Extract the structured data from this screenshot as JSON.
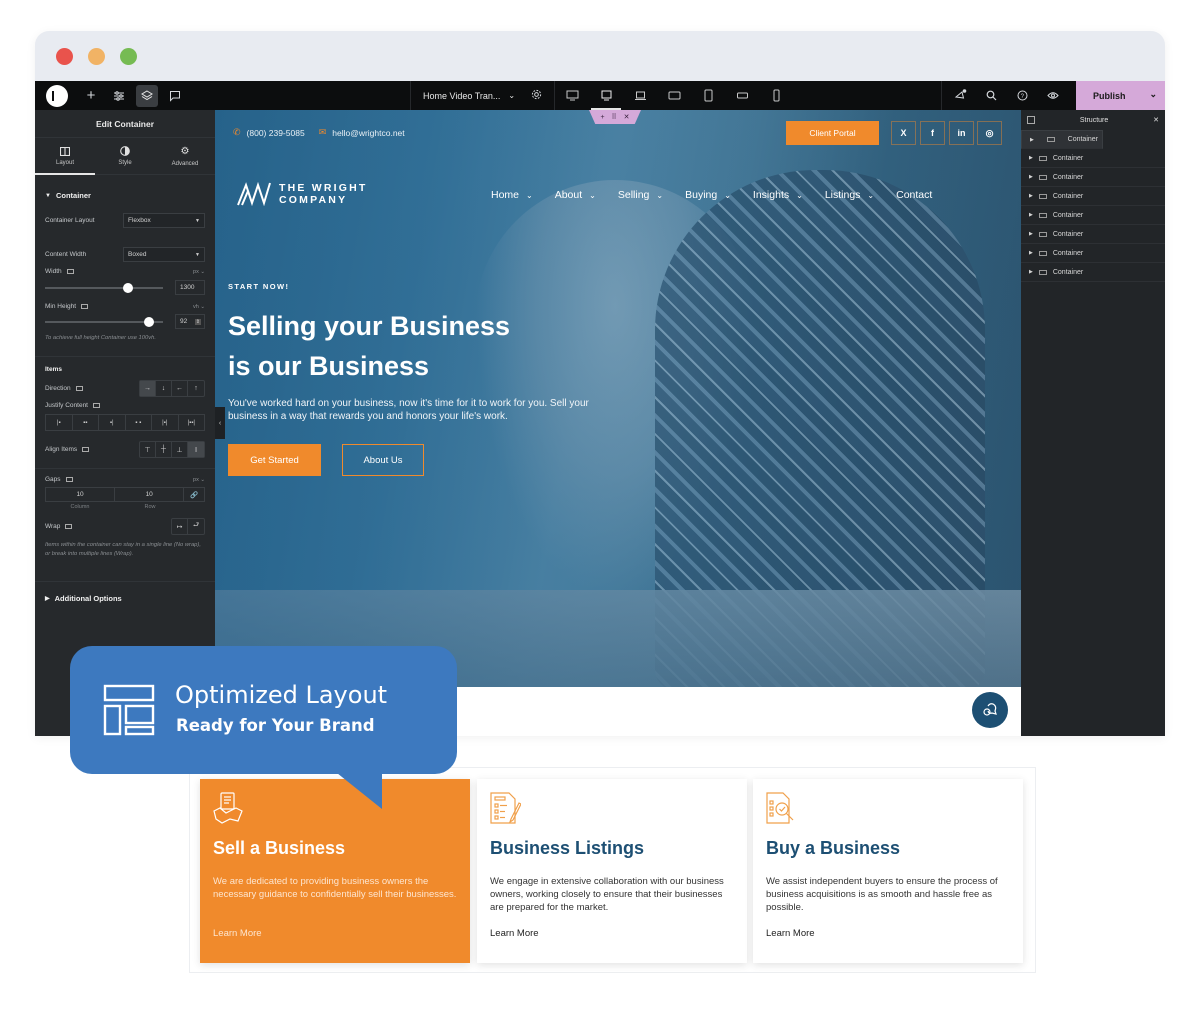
{
  "window": {
    "traffic_lights": [
      "#e9534c",
      "#f1b365",
      "#76bb53"
    ]
  },
  "topbar": {
    "page_name": "Home Video Tran...",
    "publish_label": "Publish",
    "device_modes": [
      "desktop-wide",
      "desktop",
      "laptop",
      "tablet-landscape",
      "tablet",
      "mobile-landscape",
      "mobile"
    ],
    "active_device": "desktop"
  },
  "left_panel": {
    "title": "Edit Container",
    "tabs": [
      {
        "label": "Layout",
        "icon": "columns-icon",
        "active": true
      },
      {
        "label": "Style",
        "icon": "half-circle-icon",
        "active": false
      },
      {
        "label": "Advanced",
        "icon": "gear-icon",
        "active": false
      }
    ],
    "section_container": "Container",
    "container_layout_label": "Container Layout",
    "container_layout_value": "Flexbox",
    "content_width_label": "Content Width",
    "content_width_value": "Boxed",
    "width_label": "Width",
    "width_unit": "px",
    "width_value": "1300",
    "width_slider_fraction": 0.72,
    "min_height_label": "Min Height",
    "min_height_unit": "vh",
    "min_height_value": "92",
    "min_height_slider_fraction": 0.92,
    "min_height_hint": "To achieve full height Container use 100vh.",
    "items_label": "Items",
    "direction_label": "Direction",
    "direction_options": [
      "→",
      "↓",
      "←",
      "↑"
    ],
    "justify_label": "Justify Content",
    "justify_options": [
      "|▪",
      "▪▪",
      "▪|",
      "▪ ▪",
      "|▪|",
      "|▪▪|"
    ],
    "align_label": "Align Items",
    "align_options": [
      "⊤",
      "┼",
      "⊥",
      "Ⅰ"
    ],
    "gaps_label": "Gaps",
    "gaps_unit": "px",
    "gap_column": "10",
    "gap_row": "10",
    "gap_column_label": "Column",
    "gap_row_label": "Row",
    "wrap_label": "Wrap",
    "wrap_hint": "Items within the container can stay in a single line (No wrap), or break into multiple lines (Wrap).",
    "additional_options": "Additional Options"
  },
  "site": {
    "phone": "(800) 239-5085",
    "email": "hello@wrightco.net",
    "client_portal": "Client Portal",
    "socials": [
      "X",
      "f",
      "in",
      "◎"
    ],
    "brand_line1": "THE WRIGHT",
    "brand_line2": "COMPANY",
    "nav": [
      {
        "label": "Home",
        "dropdown": true
      },
      {
        "label": "About",
        "dropdown": true
      },
      {
        "label": "Selling",
        "dropdown": true
      },
      {
        "label": "Buying",
        "dropdown": true
      },
      {
        "label": "Insights",
        "dropdown": true
      },
      {
        "label": "Listings",
        "dropdown": true
      },
      {
        "label": "Contact",
        "dropdown": false
      }
    ],
    "kicker": "START NOW!",
    "hero_line1": "Selling your Business",
    "hero_line2": "is our Business",
    "hero_sub": "You've worked hard on your business, now it's time for it to work for you. Sell your business in a way that rewards you and honors your life's work.",
    "btn_primary": "Get Started",
    "btn_secondary": "About Us",
    "accent": "#f08a2c",
    "primary": "#1d4f73"
  },
  "structure": {
    "title": "Structure",
    "items": [
      "Container",
      "Container",
      "Container",
      "Container",
      "Container",
      "Container",
      "Container",
      "Container"
    ]
  },
  "callout": {
    "title": "Optimized Layout",
    "subtitle": "Ready for Your Brand",
    "color": "#3d79bf"
  },
  "cards": [
    {
      "title": "Sell a Business",
      "text": "We are dedicated to providing business owners the necessary guidance to confidentially sell their businesses.",
      "link": "Learn More",
      "icon": "handshake-document-icon",
      "highlight": true
    },
    {
      "title": "Business Listings",
      "text": "We engage in extensive collaboration with our business owners, working closely to ensure that their businesses are prepared for the market.",
      "link": "Learn More",
      "icon": "checklist-pencil-icon",
      "highlight": false
    },
    {
      "title": "Buy a Business",
      "text": "We assist independent buyers to ensure the process of business acquisitions is as smooth and hassle free as possible.",
      "link": "Learn More",
      "icon": "document-search-icon",
      "highlight": false
    }
  ]
}
